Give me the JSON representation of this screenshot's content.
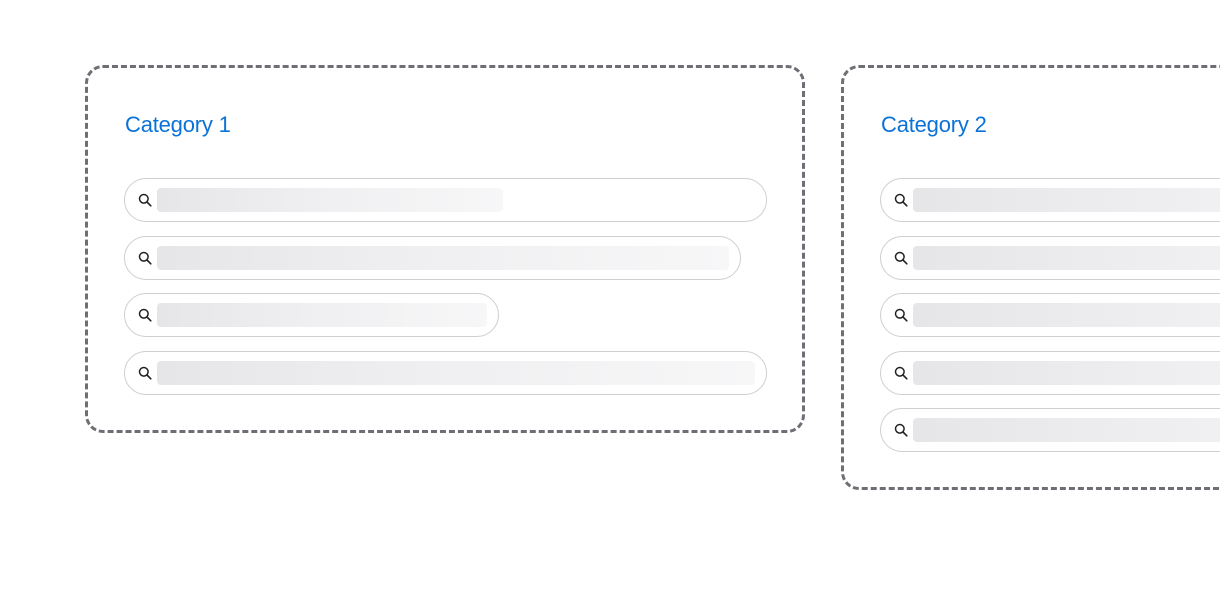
{
  "categories": [
    {
      "title": "Category 1",
      "searches": [
        {
          "label": "",
          "icon": "search-icon"
        },
        {
          "label": "",
          "icon": "search-icon"
        },
        {
          "label": "",
          "icon": "search-icon"
        },
        {
          "label": "",
          "icon": "search-icon"
        }
      ]
    },
    {
      "title": "Category 2",
      "searches": [
        {
          "label": "",
          "icon": "search-icon"
        },
        {
          "label": "",
          "icon": "search-icon"
        },
        {
          "label": "",
          "icon": "search-icon"
        },
        {
          "label": "",
          "icon": "search-icon"
        },
        {
          "label": "",
          "icon": "search-icon"
        }
      ]
    }
  ],
  "colors": {
    "accent": "#0a72d8",
    "border_dashed": "#6d6f75",
    "pill_border": "#cfcfd3",
    "skeleton": "#e6e6e8"
  }
}
